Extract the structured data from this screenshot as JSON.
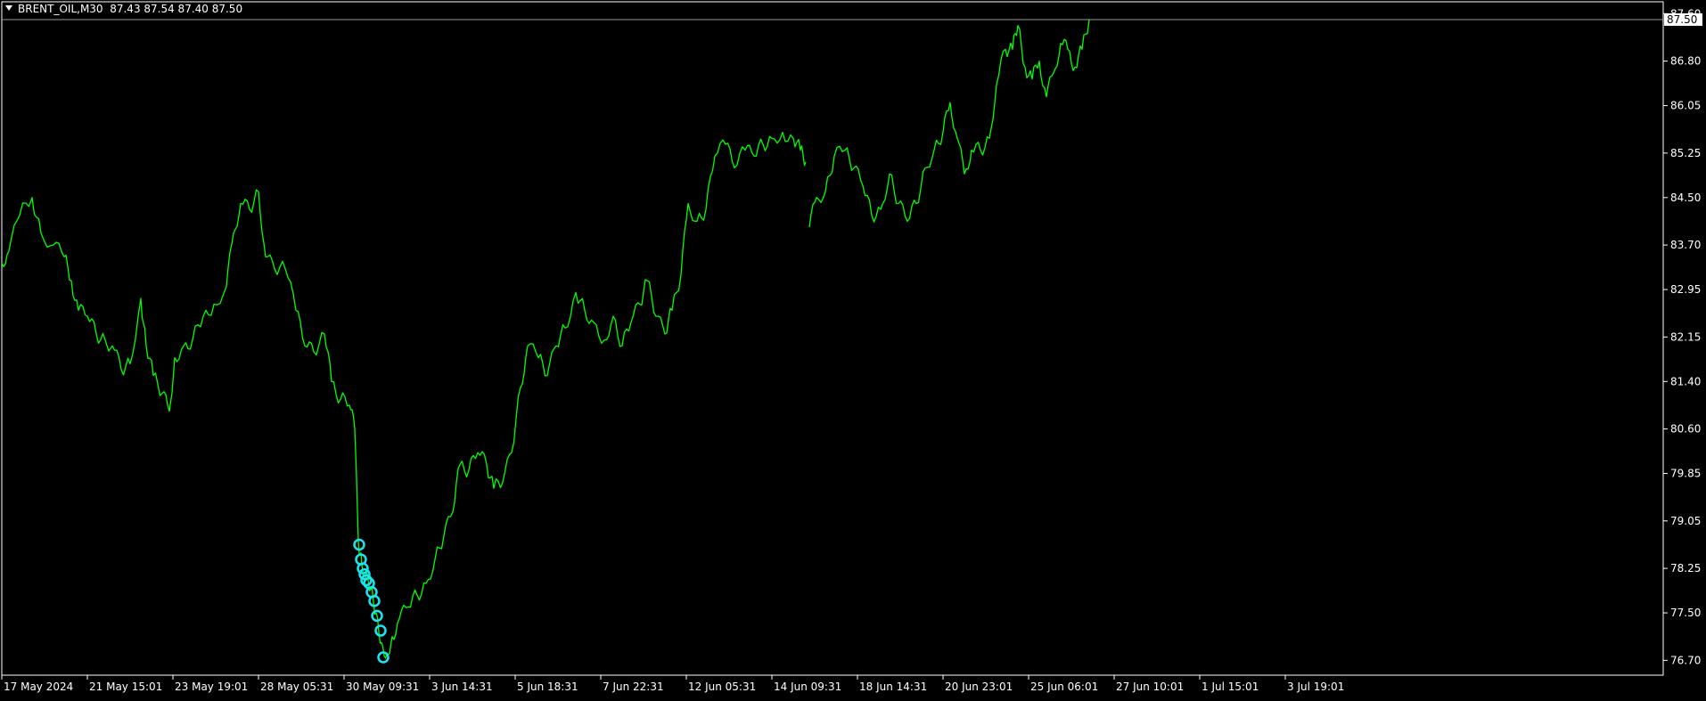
{
  "header": {
    "symbol_label": "BRENT_OIL,M30",
    "ohlc": "87.43 87.54 87.40 87.50"
  },
  "colors": {
    "background": "#000000",
    "price_line": "#00ff00",
    "marker": "#19e6f0",
    "axis": "#ffffff",
    "bid_line": "#9a9a9a"
  },
  "chart_data": {
    "type": "line",
    "symbol": "BRENT_OIL",
    "timeframe": "M30",
    "current_price": "87.50",
    "ylim": [
      76.45,
      87.8
    ],
    "y_ticks": [
      "87.60",
      "86.80",
      "86.05",
      "85.25",
      "84.50",
      "83.70",
      "82.95",
      "82.15",
      "81.40",
      "80.60",
      "79.85",
      "79.05",
      "78.25",
      "77.50",
      "76.70"
    ],
    "x_ticks": [
      "17 May 2024",
      "21 May 15:01",
      "23 May 19:01",
      "28 May 05:31",
      "30 May 09:31",
      "3 Jun 14:31",
      "5 Jun 18:31",
      "7 Jun 22:31",
      "12 Jun 05:31",
      "14 Jun 09:31",
      "18 Jun 14:31",
      "20 Jun 23:01",
      "25 Jun 06:01",
      "27 Jun 10:01",
      "1 Jul 15:01",
      "3 Jul 19:01"
    ],
    "grid": false,
    "series": [
      {
        "points": [
          [
            0,
            83.4
          ],
          [
            8,
            83.6
          ],
          [
            20,
            84.2
          ],
          [
            34,
            84.5
          ],
          [
            44,
            83.9
          ],
          [
            58,
            83.7
          ],
          [
            70,
            83.5
          ],
          [
            78,
            83.1
          ],
          [
            86,
            82.6
          ],
          [
            96,
            82.5
          ],
          [
            106,
            82.2
          ],
          [
            116,
            82.1
          ],
          [
            124,
            82.0
          ],
          [
            134,
            81.6
          ],
          [
            144,
            81.7
          ],
          [
            156,
            82.8
          ],
          [
            162,
            82.0
          ],
          [
            170,
            81.5
          ],
          [
            180,
            81.2
          ],
          [
            188,
            80.9
          ],
          [
            194,
            81.8
          ],
          [
            204,
            82.0
          ],
          [
            214,
            82.1
          ],
          [
            226,
            82.5
          ],
          [
            238,
            82.7
          ],
          [
            252,
            83.0
          ],
          [
            260,
            83.9
          ],
          [
            268,
            84.4
          ],
          [
            278,
            84.3
          ],
          [
            288,
            84.6
          ],
          [
            296,
            83.5
          ],
          [
            306,
            83.3
          ],
          [
            318,
            83.3
          ],
          [
            330,
            82.6
          ],
          [
            340,
            82.0
          ],
          [
            350,
            81.9
          ],
          [
            362,
            82.2
          ],
          [
            370,
            81.4
          ],
          [
            380,
            81.1
          ],
          [
            390,
            81.0
          ],
          [
            396,
            80.6
          ],
          [
            400,
            78.7
          ],
          [
            404,
            78.3
          ],
          [
            408,
            78.1
          ],
          [
            414,
            77.9
          ],
          [
            420,
            77.5
          ],
          [
            426,
            77.0
          ],
          [
            432,
            76.8
          ],
          [
            438,
            77.1
          ],
          [
            446,
            77.4
          ],
          [
            456,
            77.6
          ],
          [
            466,
            77.8
          ],
          [
            476,
            78.0
          ],
          [
            486,
            78.4
          ],
          [
            496,
            78.8
          ],
          [
            506,
            79.2
          ],
          [
            514,
            80.0
          ],
          [
            524,
            79.9
          ],
          [
            534,
            80.2
          ],
          [
            544,
            80.0
          ],
          [
            552,
            79.6
          ],
          [
            562,
            79.7
          ],
          [
            572,
            80.2
          ],
          [
            582,
            81.3
          ],
          [
            590,
            82.0
          ],
          [
            602,
            81.8
          ],
          [
            612,
            81.5
          ],
          [
            622,
            82.0
          ],
          [
            632,
            82.3
          ],
          [
            644,
            82.9
          ],
          [
            654,
            82.6
          ],
          [
            664,
            82.4
          ],
          [
            676,
            82.1
          ],
          [
            686,
            82.5
          ],
          [
            696,
            82.0
          ],
          [
            706,
            82.4
          ],
          [
            716,
            82.7
          ],
          [
            724,
            83.1
          ],
          [
            734,
            82.5
          ],
          [
            744,
            82.2
          ],
          [
            752,
            82.6
          ],
          [
            762,
            83.2
          ],
          [
            770,
            84.4
          ],
          [
            780,
            84.1
          ],
          [
            790,
            84.3
          ],
          [
            800,
            85.2
          ],
          [
            812,
            85.4
          ],
          [
            822,
            85.0
          ],
          [
            834,
            85.3
          ],
          [
            844,
            85.2
          ],
          [
            854,
            85.4
          ],
          [
            864,
            85.5
          ],
          [
            876,
            85.6
          ],
          [
            888,
            85.5
          ],
          [
            896,
            85.3
          ],
          [
            902,
            85.1
          ],
          null,
          [
            906,
            84.0
          ],
          [
            914,
            84.5
          ],
          [
            924,
            84.6
          ],
          [
            934,
            85.2
          ],
          [
            946,
            85.3
          ],
          [
            956,
            85.0
          ],
          [
            966,
            84.7
          ],
          [
            976,
            84.2
          ],
          [
            986,
            84.3
          ],
          [
            996,
            84.9
          ],
          [
            1006,
            84.4
          ],
          [
            1016,
            84.1
          ],
          [
            1026,
            84.4
          ],
          [
            1036,
            85.0
          ],
          [
            1046,
            85.3
          ],
          [
            1056,
            85.6
          ],
          [
            1064,
            86.1
          ],
          [
            1072,
            85.5
          ],
          [
            1080,
            84.9
          ],
          [
            1088,
            85.3
          ],
          [
            1098,
            85.3
          ],
          [
            1108,
            85.5
          ],
          [
            1116,
            86.4
          ],
          [
            1126,
            87.0
          ],
          [
            1134,
            87.0
          ],
          [
            1140,
            87.4
          ],
          [
            1148,
            86.7
          ],
          [
            1156,
            86.5
          ],
          [
            1164,
            86.8
          ],
          [
            1172,
            86.2
          ],
          [
            1180,
            86.6
          ],
          [
            1188,
            87.1
          ],
          [
            1196,
            87.0
          ],
          [
            1204,
            86.7
          ],
          [
            1212,
            87.0
          ],
          [
            1220,
            87.5
          ]
        ]
      }
    ],
    "markers": [
      [
        401,
        78.65
      ],
      [
        403,
        78.4
      ],
      [
        405,
        78.25
      ],
      [
        407,
        78.15
      ],
      [
        409,
        78.05
      ],
      [
        412,
        78.0
      ],
      [
        415,
        77.85
      ],
      [
        418,
        77.7
      ],
      [
        421,
        77.45
      ],
      [
        425,
        77.2
      ],
      [
        428,
        76.75
      ]
    ]
  }
}
